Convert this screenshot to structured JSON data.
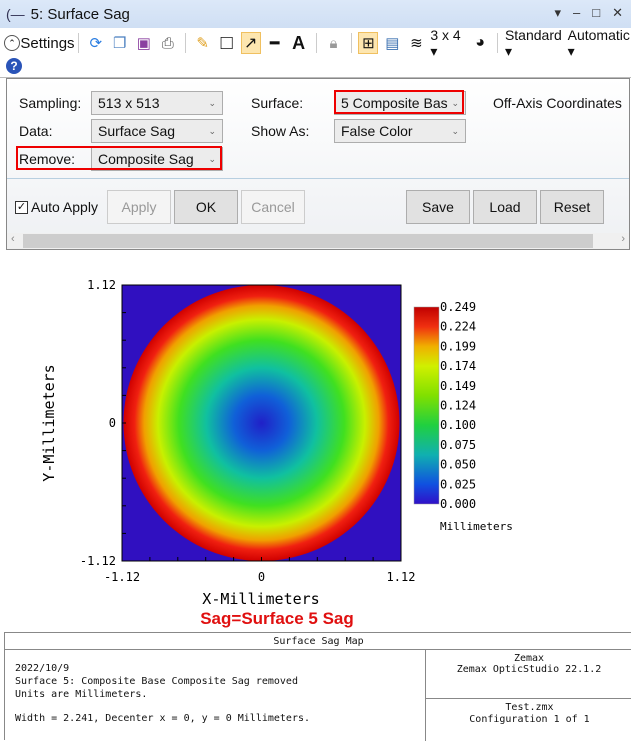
{
  "window": {
    "title": "5: Surface Sag",
    "controls": [
      "▾",
      "–",
      "□",
      "✕"
    ]
  },
  "toolbar": {
    "settings_label": "Settings",
    "layout_label": "3 x 4 ▾",
    "standard_label": "Standard ▾",
    "automatic_label": "Automatic ▾"
  },
  "settings": {
    "sampling_label": "Sampling:",
    "sampling_value": "513 x 513",
    "data_label": "Data:",
    "data_value": "Surface Sag",
    "remove_label": "Remove:",
    "remove_value": "Composite Sag",
    "surface_label": "Surface:",
    "surface_value": "5 Composite Bas",
    "show_as_label": "Show As:",
    "show_as_value": "False Color",
    "off_axis_label": "Off-Axis Coordinates",
    "auto_apply_label": "Auto Apply",
    "auto_apply_checked": true,
    "apply_label": "Apply",
    "ok_label": "OK",
    "cancel_label": "Cancel",
    "save_label": "Save",
    "load_label": "Load",
    "reset_label": "Reset"
  },
  "chart_data": {
    "type": "heatmap",
    "title": "Surface Sag Map",
    "xlabel": "X-Millimeters",
    "ylabel": "Y-Millimeters",
    "xlim": [
      -1.12,
      1.12
    ],
    "ylim": [
      -1.12,
      1.12
    ],
    "x_ticks": [
      "-1.12",
      "0",
      "1.12"
    ],
    "y_ticks": [
      "1.12",
      "0",
      "-1.12"
    ],
    "colorbar": {
      "min": 0.0,
      "max": 0.249,
      "ticks": [
        "0.249",
        "0.224",
        "0.199",
        "0.174",
        "0.149",
        "0.124",
        "0.100",
        "0.075",
        "0.050",
        "0.025",
        "0.000"
      ],
      "label": "Millimeters"
    },
    "description": "Radially symmetric sag, 0.000 at center rising to 0.249 at aperture edge; outside aperture shown as dark blue",
    "annotation": "Sag=Surface 5 Sag",
    "annotation_color": "#e01010"
  },
  "footer": {
    "title": "Surface Sag Map",
    "date": "2022/10/9",
    "line1": "Surface 5: Composite Base Composite Sag removed",
    "line2": "Units are Millimeters.",
    "line3": "Width = 2.241, Decenter x = 0, y = 0 Millimeters.",
    "vendor": "Zemax",
    "product": "Zemax OpticStudio 22.1.2",
    "file": "Test.zmx",
    "config": "Configuration 1 of 1"
  }
}
